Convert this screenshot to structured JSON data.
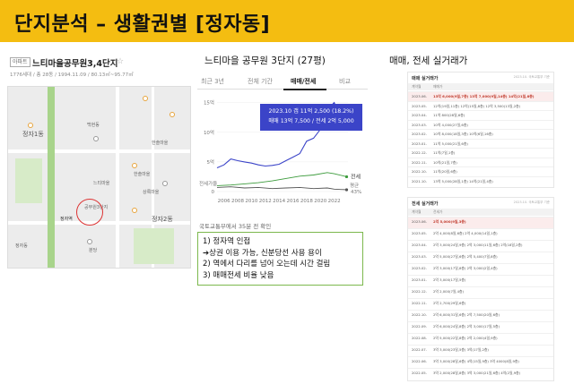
{
  "slide": {
    "title": "단지분석 – 생활권별 [정자동]",
    "accent": "#f4bd11"
  },
  "left": {
    "tag": "아파트",
    "name": "느티마을공무원3,4단지",
    "meta": "1776세대 / 총 28동 / 1994.11.09 / 80.13㎡~95.77㎡",
    "map_labels": {
      "l1": "정자1동",
      "l2": "정자2동",
      "l3": "정자역",
      "l4": "한솔마을",
      "l5": "느티마을",
      "l6": "공무원3단지",
      "l7": "백현동",
      "l8": "한솔마을",
      "l9": "상록마을",
      "l10": "정자동",
      "l11": "분당"
    }
  },
  "mid": {
    "title": "느티마을 공무원 3단지 (27평)",
    "tabs": [
      "최근 3년",
      "전체 기간",
      "매매/전세",
      "비교"
    ],
    "tooltip_line1": "2023.10  갭 11억 2,500 (18.2%)",
    "tooltip_line2": "매매 13억 7,500 / 전세 2억 5,000",
    "source": "국토교통부에서 35분 전 확인",
    "notes": [
      "1) 정자역 인접",
      "➔상권 이용 가능, 신분당선 사용 용이",
      "2) 역에서 다리를 넘어 오는데 시간 걸림",
      "3) 매매전세 비율 낮음"
    ]
  },
  "chart_data": {
    "type": "line",
    "x_ticks": [
      "2006",
      "2008",
      "2010",
      "2012",
      "2014",
      "2016",
      "2018",
      "2020",
      "2022"
    ],
    "y_ticks": [
      "15억",
      "10억",
      "5억",
      "0"
    ],
    "ylim": [
      0,
      16
    ],
    "series": [
      {
        "name": "매매",
        "color": "#3b44c8",
        "x": [
          2005,
          2006,
          2007,
          2008,
          2009,
          2010,
          2011,
          2012,
          2013,
          2014,
          2015,
          2016,
          2017,
          2018,
          2019,
          2020,
          2021,
          2022,
          2023,
          2023.8
        ],
        "values": [
          4.0,
          4.5,
          5.5,
          5.2,
          5.0,
          4.8,
          4.5,
          4.3,
          4.4,
          4.6,
          5.2,
          5.8,
          6.4,
          8.5,
          9.0,
          10.5,
          13.8,
          15.0,
          12.5,
          13.75
        ]
      },
      {
        "name": "전세",
        "color": "#3c9b3c",
        "x": [
          2005,
          2007,
          2009,
          2011,
          2013,
          2015,
          2017,
          2019,
          2021,
          2022,
          2023.8
        ],
        "values": [
          1.0,
          1.1,
          1.3,
          1.5,
          1.8,
          2.2,
          2.6,
          2.8,
          3.2,
          3.0,
          2.5
        ]
      },
      {
        "name": "갭",
        "color": "#555555",
        "x": [
          2005,
          2007,
          2009,
          2011,
          2013,
          2015,
          2017,
          2019,
          2021,
          2022,
          2023.8
        ],
        "values": [
          -0.1,
          0.0,
          -0.2,
          -0.1,
          -0.3,
          -0.2,
          -0.1,
          -0.3,
          -0.2,
          -0.4,
          -0.5
        ]
      }
    ],
    "labels": {
      "sale": "매매",
      "jeonse": "전세",
      "ratio": "평균",
      "ratio_value": "43%",
      "gap": "전세가율"
    }
  },
  "right": {
    "title": "매매, 전세 실거래가",
    "sales_table": {
      "title": "매매 실거래가",
      "note": "2023.10. 국토교통부 기준",
      "headers": [
        "계약월",
        "매매가"
      ],
      "rows": [
        {
          "date": "2023.06.",
          "val": "13억 6,000(9일,7층)   13억 7,000(9일,14층)   14억(21일,8층)",
          "hl": true
        },
        {
          "date": "2023.05.",
          "val": "12억(19일,11층)   12억(15일,8층)   12억 3,500(13일,2층)"
        },
        {
          "date": "2023.04.",
          "val": "11억 800(28일,6층)"
        },
        {
          "date": "2023.03.",
          "val": "10억 4,000(27일,6층)"
        },
        {
          "date": "2023.02.",
          "val": "10억 8,000(18일,3층)   10억(6일,16층)"
        },
        {
          "date": "2023.01.",
          "val": "11억 5,000(21일,6층)"
        },
        {
          "date": "2022.12.",
          "val": "11억(7일,1층)"
        },
        {
          "date": "2022.11.",
          "val": "10억(21일,7층)"
        },
        {
          "date": "2022.10.",
          "val": "11억(20일,6층)"
        },
        {
          "date": "2021.10.",
          "val": "13억 5,000(28일,1층)   14억(21일,4층)"
        }
      ]
    },
    "jeonse_table": {
      "title": "전세 실거래가",
      "note": "2023.10. 국토교통부 기준",
      "headers": [
        "계약월",
        "전세가"
      ],
      "rows": [
        {
          "date": "2023.06.",
          "val": "2억 5,000(9일,3층)",
          "hl": true
        },
        {
          "date": "2023.05.",
          "val": "2억 4,000(8일,6층)   2억 4,000(14일,1층)"
        },
        {
          "date": "2023.04.",
          "val": "2억 3,000(24일,9층)   2억 3,000(11일,6층)   2억(18일,2층)"
        },
        {
          "date": "2023.03.",
          "val": "2억 5,000(27일,6층)   2억 5,400(7일,8층)"
        },
        {
          "date": "2023.02.",
          "val": "2억 3,000(17일,8층)   2억 3,000(2일,4층)"
        },
        {
          "date": "2023.01.",
          "val": "2억 3,000(17일,5층)"
        },
        {
          "date": "2022.12.",
          "val": "2억 2,000(7일,4층)"
        },
        {
          "date": "2022.11.",
          "val": "2억 2,700(29일,6층)"
        },
        {
          "date": "2022.10.",
          "val": "2억 6,000(31일,6층)   2억 7,500(20일,6층)"
        },
        {
          "date": "2022.09.",
          "val": "2억 6,000(24일,8층)   2억 3,000(17일,5층)"
        },
        {
          "date": "2022.08.",
          "val": "2억 5,000(22일,8층)   2억 2,000(4일,9층)"
        },
        {
          "date": "2022.07.",
          "val": "3억 3,000(23일,5층)   3억(17일,2층)"
        },
        {
          "date": "2022.06.",
          "val": "3억 3,000(28일,6층)   4억(15일,9층)   3억 4000(8일,9층)"
        },
        {
          "date": "2022.05.",
          "val": "3억 2,000(28일,8층)   3억 3,000(21일,6층)   4억(2일,9층)"
        }
      ]
    }
  }
}
